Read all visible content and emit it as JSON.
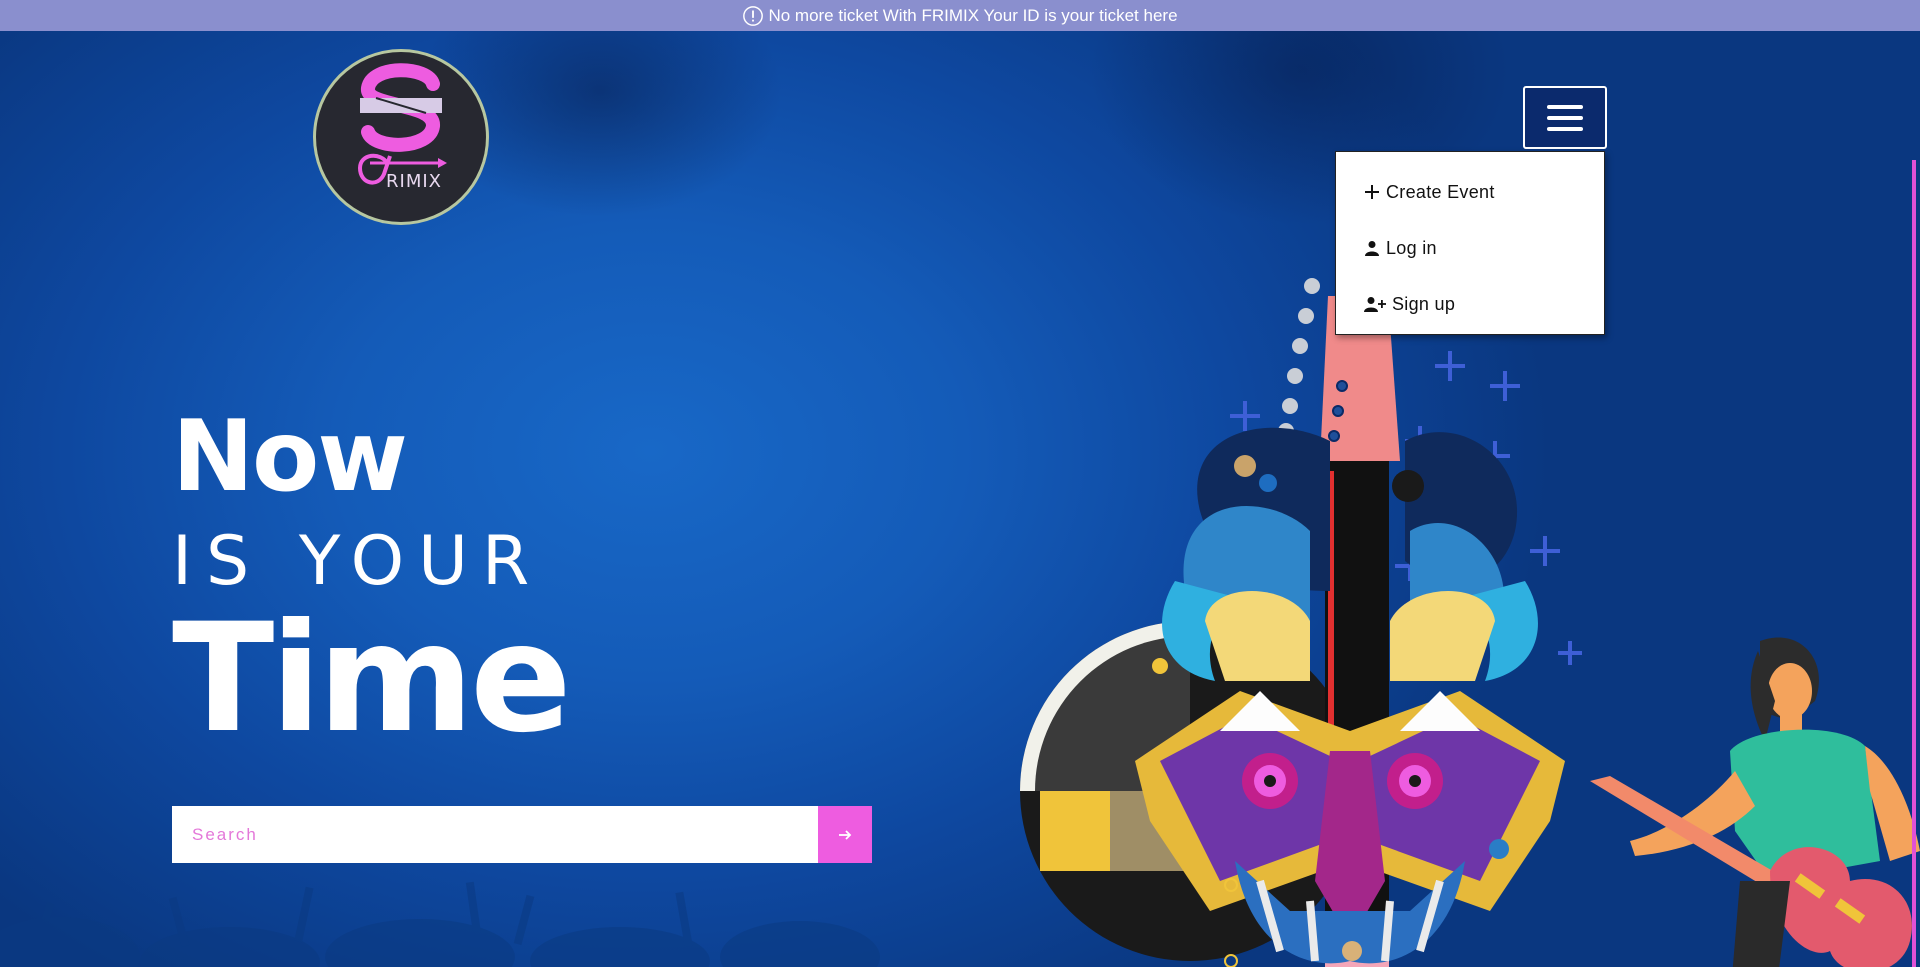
{
  "announcement": {
    "icon": "info-circle-icon",
    "text": "No more ticket With FRIMIX Your ID is your ticket here"
  },
  "logo": {
    "text": "RIMIX",
    "brand": "FRIMIX",
    "colors": {
      "accent": "#ee5ce0",
      "background": "#272830",
      "ring": "#b7c7a0"
    }
  },
  "nav": {
    "menu_icon": "hamburger-menu-icon",
    "dropdown": [
      {
        "icon": "plus-icon",
        "label": "Create Event"
      },
      {
        "icon": "user-icon",
        "label": "Log in"
      },
      {
        "icon": "user-plus-icon",
        "label": "Sign up"
      }
    ]
  },
  "hero": {
    "line1": "Now",
    "line2": "IS YOUR",
    "line3": "Time"
  },
  "search": {
    "placeholder": "Search",
    "value": "",
    "button_icon": "arrow-right-icon"
  },
  "colors": {
    "announcement_bg": "#8a8fce",
    "hero_bg": "#145bb8",
    "accent": "#ee5ce0",
    "white": "#ffffff"
  }
}
